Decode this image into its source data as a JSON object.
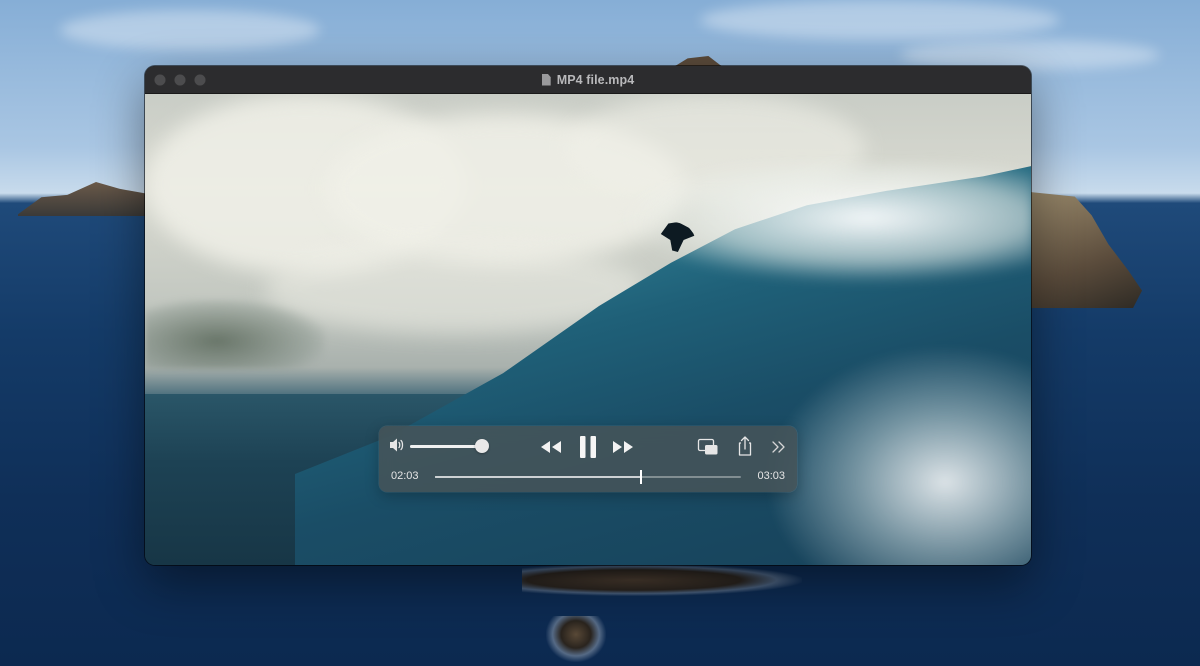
{
  "window": {
    "title": "MP4 file.mp4",
    "title_icon": "document-icon"
  },
  "traffic_lights": [
    "close-button",
    "minimize-button",
    "zoom-button"
  ],
  "player": {
    "elapsed": "02:03",
    "total": "03:03",
    "progress": 0.672,
    "volume": 0.96,
    "state": "playing",
    "controls": {
      "volume_icon": "speaker-icon",
      "rewind_icon": "rewind-icon",
      "pause_icon": "pause-icon",
      "forward_icon": "fast-forward-icon",
      "pip_icon": "picture-in-picture-icon",
      "share_icon": "share-icon",
      "more_icon": "chevron-double-right-icon"
    }
  }
}
